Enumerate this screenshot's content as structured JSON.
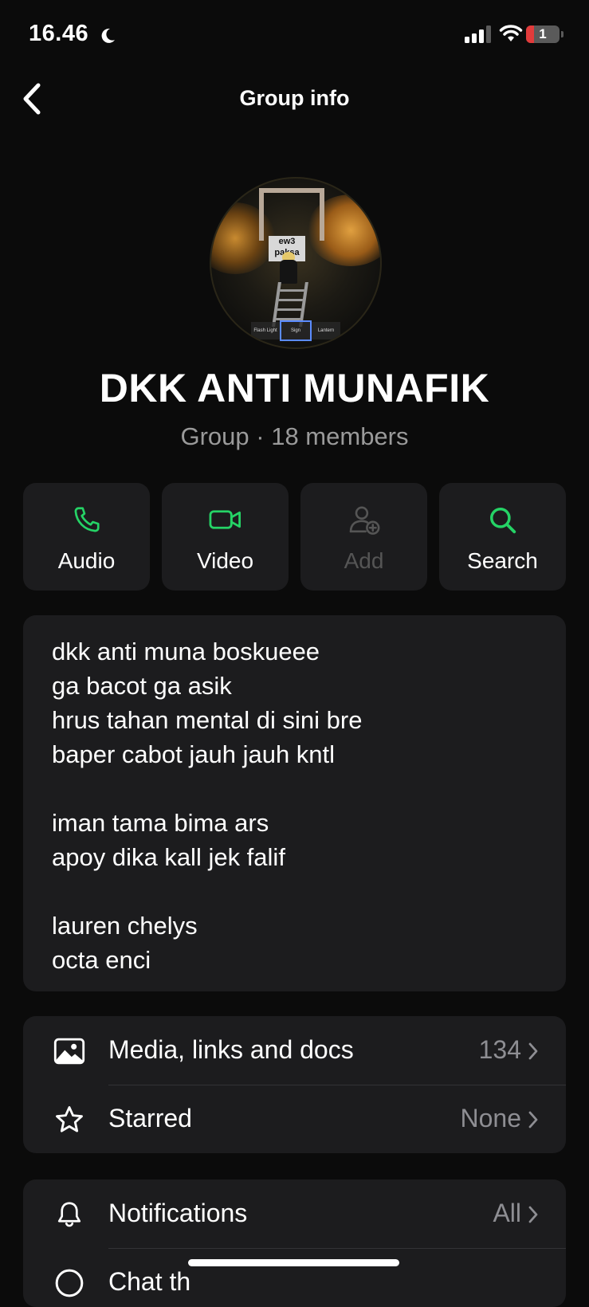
{
  "status_bar": {
    "time": "16.46",
    "battery": "1"
  },
  "nav": {
    "title": "Group info"
  },
  "group": {
    "name": "DKK ANTI MUNAFIK",
    "subtitle": "Group · 18 members"
  },
  "avatar_text": {
    "sign": "ew3\npaksa",
    "slots": [
      "Flash Light",
      "Sign",
      "Lantern"
    ]
  },
  "actions": [
    {
      "label": "Audio",
      "icon": "phone-icon",
      "enabled": true
    },
    {
      "label": "Video",
      "icon": "video-icon",
      "enabled": true
    },
    {
      "label": "Add",
      "icon": "add-user-icon",
      "enabled": false
    },
    {
      "label": "Search",
      "icon": "search-icon",
      "enabled": true
    }
  ],
  "description": "dkk anti muna boskueee\nga bacot ga asik\nhrus tahan mental di sini bre\nbaper cabot jauh jauh kntl\n\niman tama bima ars\napoy dika kall jek falif\n\nlauren chelys\nocta enci",
  "list1": [
    {
      "label": "Media, links and docs",
      "value": "134",
      "icon": "photo-icon"
    },
    {
      "label": "Starred",
      "value": "None",
      "icon": "star-icon"
    }
  ],
  "list2": [
    {
      "label": "Notifications",
      "value": "All",
      "icon": "bell-icon"
    },
    {
      "label": "Chat th",
      "value": "",
      "icon": "chat-theme-icon"
    }
  ],
  "colors": {
    "accent": "#25d366",
    "background": "#0b0b0b",
    "card": "#1c1c1e",
    "secondary_text": "#8e8e93"
  }
}
